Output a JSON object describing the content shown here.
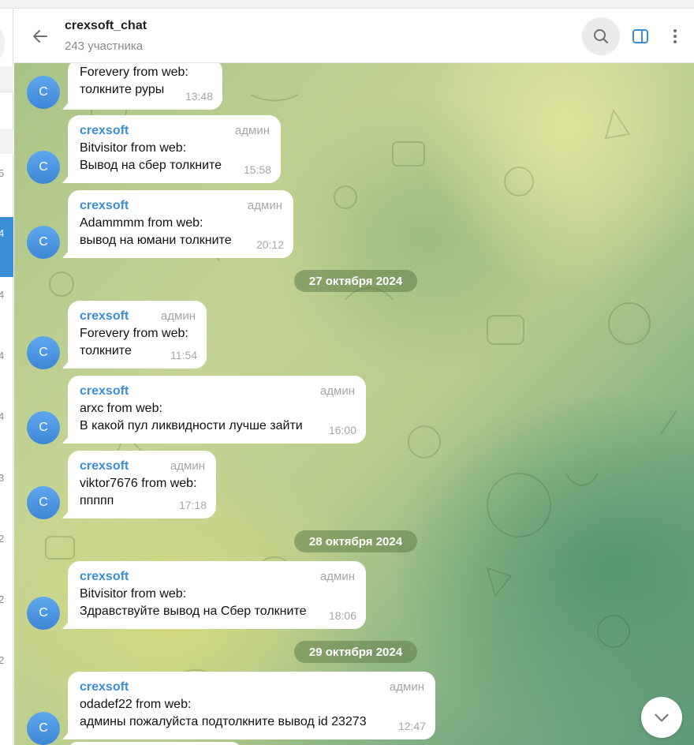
{
  "header": {
    "title": "crexsoft_chat",
    "subtitle": "243 участника"
  },
  "left_digits": [
    "5",
    "4",
    "4",
    "4",
    "4",
    "3",
    "2",
    "2",
    "2"
  ],
  "messages": [
    {
      "sender": "",
      "role": "",
      "lines": [
        "Forevery from web:",
        "толкните руры"
      ],
      "time": "13:48",
      "avatar": "C"
    },
    {
      "sender": "crexsoft",
      "role": "админ",
      "lines": [
        "Bitvisitor from web:",
        "Вывод на сбер толкните"
      ],
      "time": "15:58",
      "avatar": "C"
    },
    {
      "sender": "crexsoft",
      "role": "админ",
      "lines": [
        "Adammmm from web:",
        "вывод на юмани толкните"
      ],
      "time": "20:12",
      "avatar": "C"
    },
    {
      "sender": "crexsoft",
      "role": "админ",
      "lines": [
        "Forevery from web:",
        "толкните"
      ],
      "time": "11:54",
      "avatar": "C"
    },
    {
      "sender": "crexsoft",
      "role": "админ",
      "lines": [
        "arxc from web:",
        "В какой пул ликвидности лучше зайти"
      ],
      "time": "16:00",
      "avatar": "C"
    },
    {
      "sender": "crexsoft",
      "role": "админ",
      "lines": [
        "viktor7676 from web:",
        "ппппп"
      ],
      "time": "17:18",
      "avatar": "C"
    },
    {
      "sender": "crexsoft",
      "role": "админ",
      "lines": [
        "Bitvisitor from web:",
        "Здравствуйте вывод на Сбер толкните"
      ],
      "time": "18:06",
      "avatar": "C"
    },
    {
      "sender": "crexsoft",
      "role": "админ",
      "lines": [
        "odadef22 from web:",
        "админы  пожалуйста подтолкните вывод id 23273"
      ],
      "time": "12:47",
      "avatar": "C"
    }
  ],
  "dates": [
    "27 октября 2024",
    "28 октября 2024",
    "29 октября 2024"
  ],
  "colors": {
    "accent": "#3a8fd3",
    "avatar": "#4a93e0",
    "date_pill": "#6d8a55"
  },
  "icons": {
    "back": "arrow-left-icon",
    "search": "search-icon",
    "sidebar": "sidebar-toggle-icon",
    "more": "more-vertical-icon",
    "scroll": "chevron-down-icon"
  }
}
